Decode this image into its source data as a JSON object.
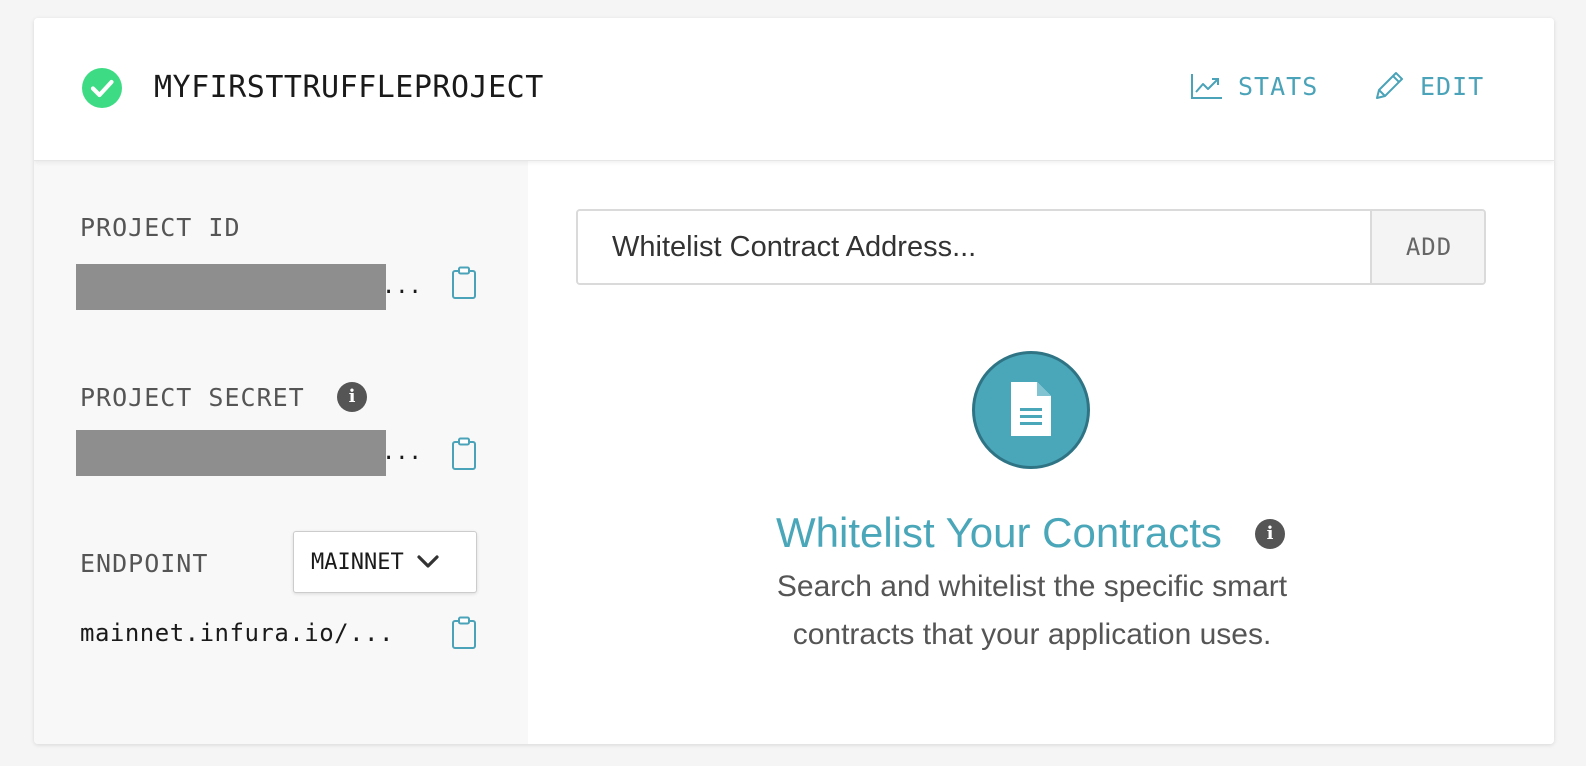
{
  "project": {
    "name": "MYFIRSTTRUFFLEPROJECT",
    "status_icon": "check-circle-icon",
    "status_color": "#3ddc84"
  },
  "header": {
    "stats_label": "STATS",
    "edit_label": "EDIT",
    "accent_color": "#4aa3b8"
  },
  "sidebar": {
    "project_id": {
      "label": "PROJECT ID",
      "value_tail": "...",
      "copy_icon": "clipboard-icon"
    },
    "project_secret": {
      "label": "PROJECT SECRET",
      "info_icon": "info-icon",
      "value_tail": "...",
      "copy_icon": "clipboard-icon"
    },
    "endpoint": {
      "label": "ENDPOINT",
      "network_selected": "MAINNET",
      "url": "mainnet.infura.io/...",
      "copy_icon": "clipboard-icon"
    }
  },
  "whitelist": {
    "placeholder": "Whitelist Contract Address...",
    "add_label": "ADD",
    "empty_icon": "document-icon",
    "empty_title": "Whitelist Your Contracts",
    "empty_description": "Search and whitelist the specific smart contracts that your application uses.",
    "title_color": "#4aa6b9"
  }
}
